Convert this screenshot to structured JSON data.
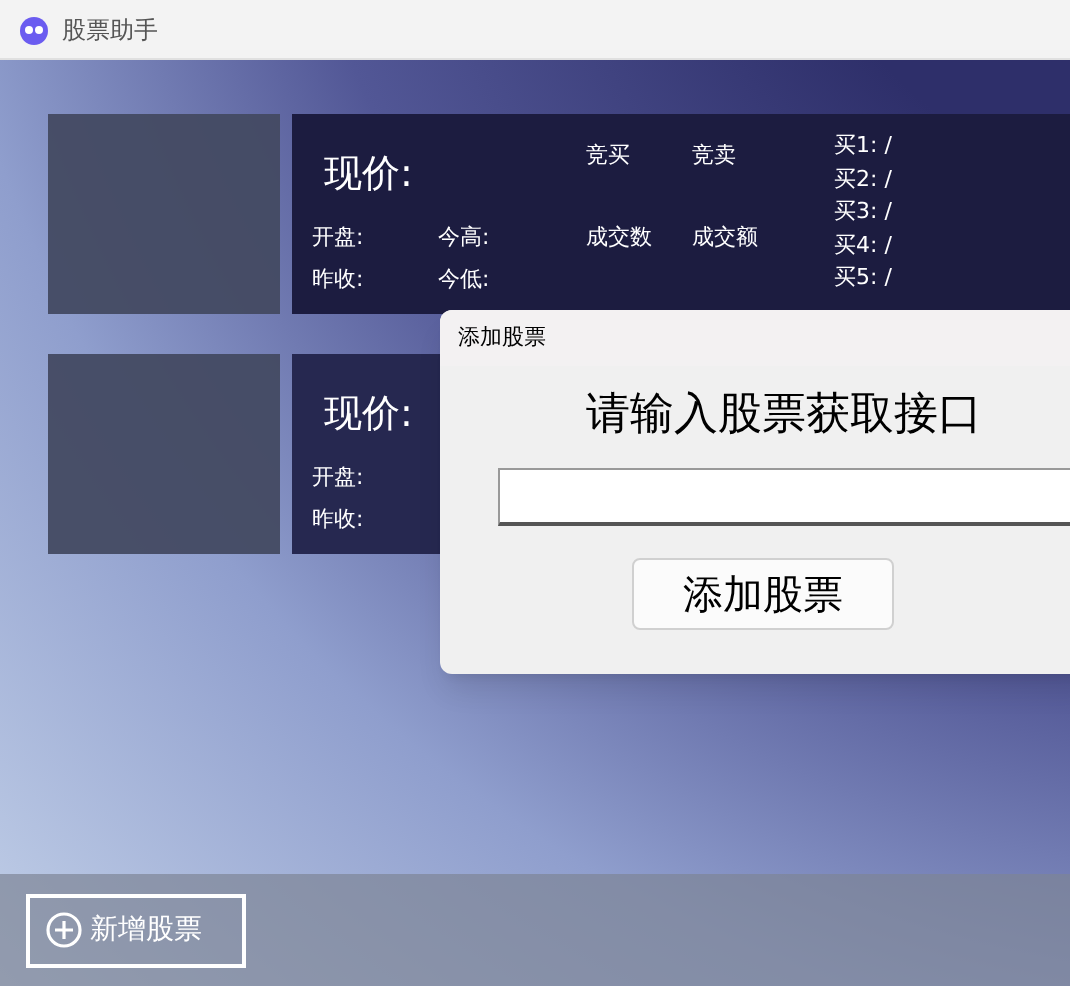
{
  "window": {
    "title": "股票助手"
  },
  "stocks": [
    {
      "price_label": "现价:",
      "bid_label": "竞买",
      "ask_label": "竞卖",
      "open_label": "开盘:",
      "high_label": "今高:",
      "volume_label": "成交数",
      "amount_label": "成交额",
      "prev_close_label": "昨收:",
      "low_label": "今低:",
      "buy_levels": [
        "买1: /",
        "买2: /",
        "买3: /",
        "买4: /",
        "买5: /"
      ]
    },
    {
      "price_label": "现价:",
      "open_label": "开盘:",
      "prev_close_label": "昨收:"
    }
  ],
  "dialog": {
    "title": "添加股票",
    "prompt": "请输入股票获取接口",
    "button": "添加股票"
  },
  "bottom_bar": {
    "add_button": "新增股票"
  }
}
